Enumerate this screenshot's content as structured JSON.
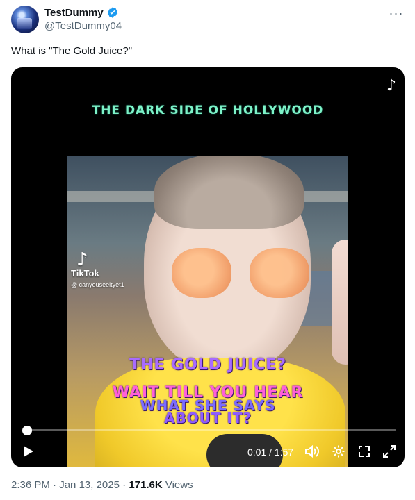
{
  "author": {
    "display_name": "TestDummy",
    "handle": "@TestDummy04",
    "verified": true
  },
  "menu": {
    "more_icon": "more-horizontal-icon",
    "label": "···"
  },
  "tweet": {
    "text": "What is \"The Gold Juice?\""
  },
  "video": {
    "caption_top": "THE DARK SIDE OF HOLLYWOOD",
    "watermark": {
      "brand": "TikTok",
      "user": "@ canyouseeityet1"
    },
    "overlay_line1": "THE GOLD JUICE?",
    "overlay_line2": "WAIT TILL YOU HEAR",
    "overlay_line3": "WHAT SHE SAYS",
    "overlay_line4": "ABOUT IT?",
    "corner_glyph": "♪",
    "time_display": "0:01 / 1:57",
    "progress": 0.009,
    "icons": [
      "play-icon",
      "volume-icon",
      "settings-icon",
      "pip-icon",
      "fullscreen-icon"
    ]
  },
  "meta": {
    "time": "2:36 PM",
    "date": "Jan 13, 2025",
    "views_count": "171.6K",
    "views_label": "Views",
    "sep": "·"
  },
  "colors": {
    "verified": "#1d9bf0",
    "text": "#0f1419",
    "muted": "#536471"
  }
}
